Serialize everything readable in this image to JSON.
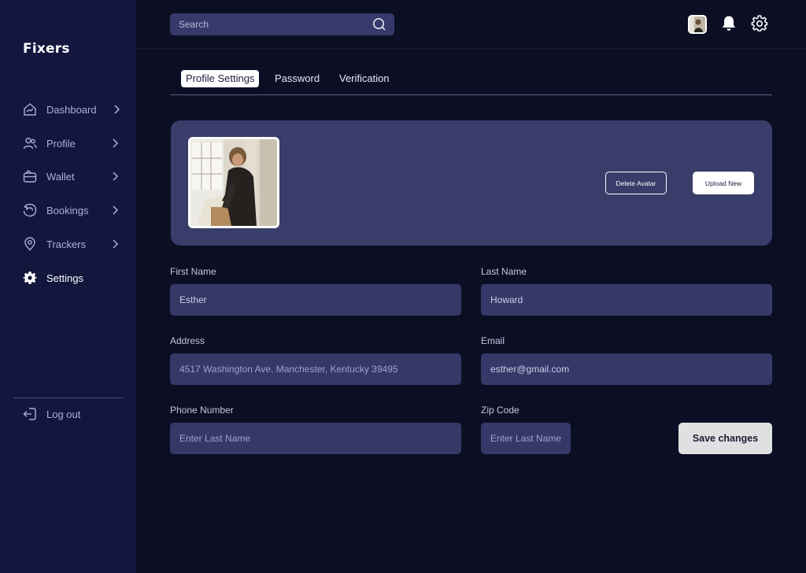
{
  "brand": {
    "name": "Fixers"
  },
  "sidebar": {
    "items": [
      {
        "label": "Dashboard",
        "icon": "dashboard-icon"
      },
      {
        "label": "Profile",
        "icon": "profile-icon"
      },
      {
        "label": "Wallet",
        "icon": "wallet-icon"
      },
      {
        "label": "Bookings",
        "icon": "bookings-icon"
      },
      {
        "label": "Trackers",
        "icon": "location-icon"
      },
      {
        "label": "Settings",
        "icon": "settings-icon",
        "active": true
      }
    ],
    "logout_label": "Log out"
  },
  "topbar": {
    "search_placeholder": "Search"
  },
  "tabs": [
    {
      "label": "Profile Settings",
      "active": true
    },
    {
      "label": "Password"
    },
    {
      "label": "Verification"
    }
  ],
  "avatar_card": {
    "delete_label": "Delete Avatar",
    "upload_label": "Upload New"
  },
  "form": {
    "first_name": {
      "label": "First Name",
      "value": "Esther"
    },
    "last_name": {
      "label": "Last Name",
      "value": "Howard"
    },
    "address": {
      "label": "Address",
      "placeholder": "4517 Washington Ave. Manchester, Kentucky 39495"
    },
    "email": {
      "label": "Email",
      "value": "esther@gmail.com"
    },
    "phone": {
      "label": "Phone Number",
      "placeholder": "Enter Last Name"
    },
    "zip": {
      "label": "Zip Code",
      "placeholder": "Enter Last Name"
    },
    "save_label": "Save changes"
  },
  "colors": {
    "background": "#0c0f24",
    "sidebar": "#13173d",
    "card": "#383d69",
    "input": "#343968",
    "save_button": "#e0e0e2"
  }
}
